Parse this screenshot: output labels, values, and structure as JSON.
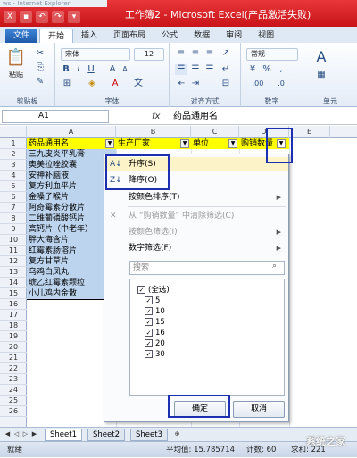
{
  "window": {
    "top_strip": "ws - Internet Explorer",
    "title": "工作簿2 - Microsoft Excel(产品激活失败)"
  },
  "ribbon": {
    "tabs": [
      "文件",
      "开始",
      "插入",
      "页面布局",
      "公式",
      "数据",
      "审阅",
      "视图"
    ],
    "active_tab": "开始",
    "font_name": "宋体",
    "font_size": "12",
    "number_format": "常规",
    "paste_label": "粘贴",
    "groups": {
      "clipboard": "剪贴板",
      "font": "字体",
      "alignment": "对齐方式",
      "number": "数字",
      "styles": "单元"
    }
  },
  "formula_bar": {
    "name_box": "A1",
    "fx": "fx",
    "content": "药品通用名"
  },
  "sheet": {
    "columns": [
      "A",
      "B",
      "C",
      "D",
      "E"
    ],
    "header_row": [
      "药品通用名",
      "生产厂家",
      "单位",
      "购销数量"
    ],
    "col_a": [
      "三九皮炎平乳膏",
      "奥美拉唑胶囊",
      "安神补脑液",
      "复方利血平片",
      "金嗓子喉片",
      "阿奇霉素分散片",
      "二维葡磷酸钙片",
      "高钙片（中老年）",
      "胖大海含片",
      "红霉素肠溶片",
      "复方甘草片",
      "乌鸡白凤丸",
      "琥乙红霉素颗粒",
      "小儿鸡内金散"
    ],
    "row_numbers": [
      "1",
      "2",
      "3",
      "4",
      "5",
      "6",
      "7",
      "8",
      "9",
      "10",
      "11",
      "12",
      "13",
      "14",
      "15",
      "16",
      "17",
      "18",
      "19",
      "20",
      "21",
      "22",
      "23",
      "24",
      "25",
      "26"
    ]
  },
  "filter_menu": {
    "sort_asc": "升序(S)",
    "sort_desc": "降序(O)",
    "sort_by_color": "按颜色排序(T)",
    "clear_filter": "从 “购销数量” 中清除筛选(C)",
    "filter_by_color": "按颜色筛选(I)",
    "number_filters": "数字筛选(F)",
    "search_placeholder": "搜索",
    "items": [
      "(全选)",
      "5",
      "10",
      "15",
      "16",
      "20",
      "30"
    ],
    "ok": "确定",
    "cancel": "取消"
  },
  "sheet_tabs": [
    "Sheet1",
    "Sheet2",
    "Sheet3"
  ],
  "status": {
    "ready": "就绪",
    "average": "平均值: 15.785714",
    "count": "计数: 60",
    "sum": "求和: 221"
  },
  "watermark": "系统之家"
}
